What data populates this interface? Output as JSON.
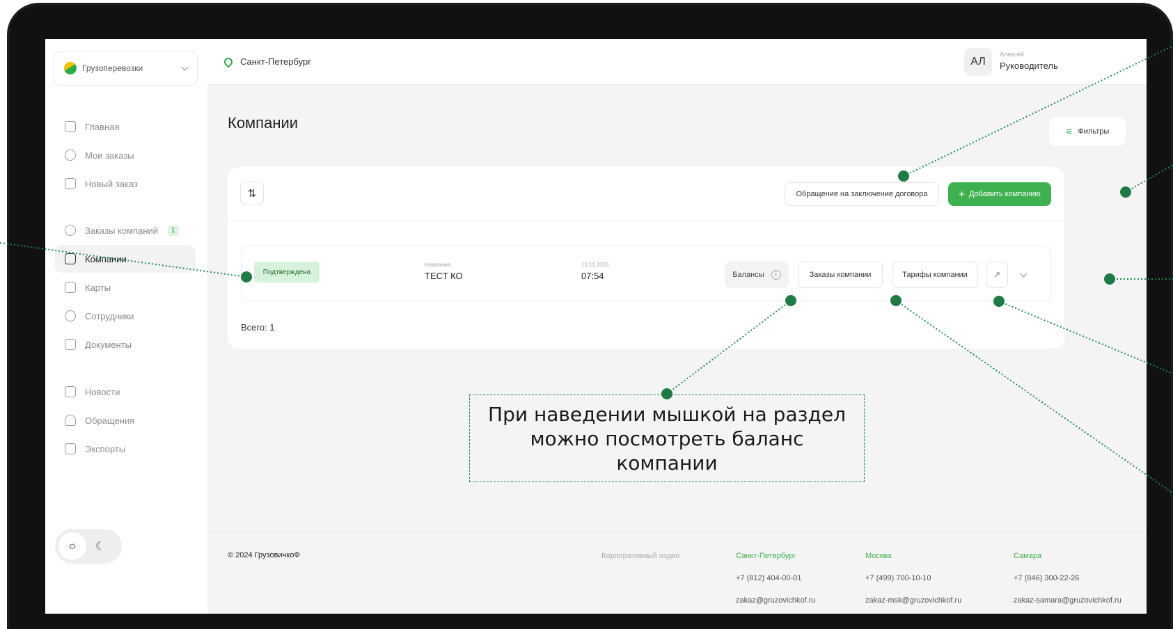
{
  "sidebar": {
    "service": "Грузоперевозки",
    "items": [
      {
        "label": "Главная"
      },
      {
        "label": "Мои заказы"
      },
      {
        "label": "Новый заказ"
      },
      {
        "label": "Заказы компаний",
        "badge": "1"
      },
      {
        "label": "Компании"
      },
      {
        "label": "Карты"
      },
      {
        "label": "Сотрудники"
      },
      {
        "label": "Документы"
      },
      {
        "label": "Новости"
      },
      {
        "label": "Обращения"
      },
      {
        "label": "Экспорты"
      }
    ],
    "active": "Компании"
  },
  "header": {
    "city": "Санкт-Петербург",
    "user": {
      "initials": "АЛ",
      "name": "Алексей",
      "role": "Руководитель"
    }
  },
  "main": {
    "title": "Компании",
    "filters_label": "Фильтры",
    "appeal_label": "Обращение на заключение договора",
    "add_label": "Добавить компанию",
    "row": {
      "status": "Подтверждена",
      "company_caption": "Компания",
      "company": "ТЕСТ КО",
      "date": "19.11.2020",
      "time": "07:54",
      "balances_label": "Балансы",
      "orders_label": "Заказы компании",
      "tariffs_label": "Тарифы компании"
    },
    "total": "Всего: 1"
  },
  "footer": {
    "copyright": "© 2024 ГрузовичкоФ",
    "dept": "Корпоративный отдел",
    "offices": [
      {
        "city": "Санкт-Петербург",
        "phone": "+7 (812) 404-00-01",
        "email": "zakaz@gruzovichkof.ru"
      },
      {
        "city": "Москва",
        "phone": "+7 (499) 700-10-10",
        "email": "zakaz-msk@gruzovichkof.ru"
      },
      {
        "city": "Самара",
        "phone": "+7 (846) 300-22-26",
        "email": "zakaz-samara@gruzovichkof.ru"
      }
    ]
  },
  "annotation": {
    "text": "При наведении мышкой на раздел можно посмотреть баланс компании"
  },
  "colors": {
    "accent": "#3fb04f",
    "annotation": "#1f8a4c"
  }
}
